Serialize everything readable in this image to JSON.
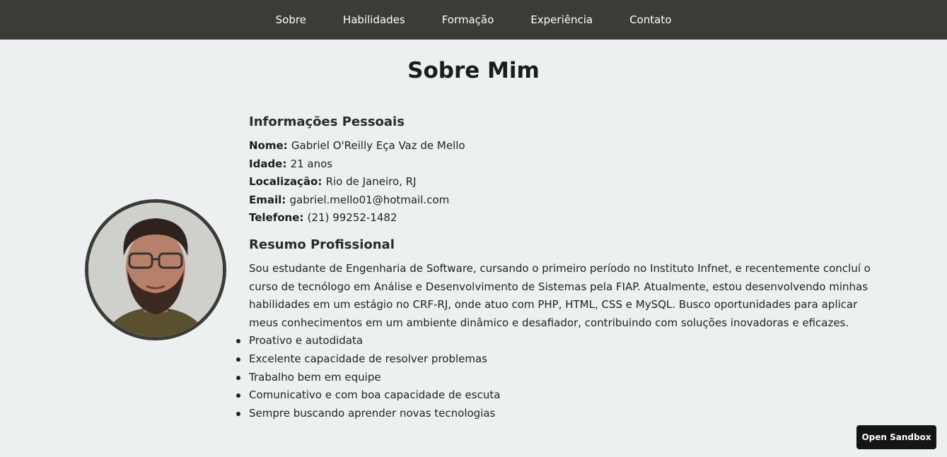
{
  "nav": {
    "items": [
      "Sobre",
      "Habilidades",
      "Formação",
      "Experiência",
      "Contato"
    ]
  },
  "page": {
    "title": "Sobre Mim"
  },
  "personal": {
    "heading": "Informações Pessoais",
    "rows": [
      {
        "label": "Nome:",
        "value": "Gabriel O'Reilly Eça Vaz de Mello"
      },
      {
        "label": "Idade:",
        "value": "21 anos"
      },
      {
        "label": "Localização:",
        "value": "Rio de Janeiro, RJ"
      },
      {
        "label": "Email:",
        "value": "gabriel.mello01@hotmail.com"
      },
      {
        "label": "Telefone:",
        "value": "(21) 99252-1482"
      }
    ]
  },
  "summary": {
    "heading": "Resumo Profissional",
    "text": "Sou estudante de Engenharia de Software, cursando o primeiro período no Instituto Infnet, e recentemente concluí o curso de tecnólogo em Análise e Desenvolvimento de Sistemas pela FIAP. Atualmente, estou desenvolvendo minhas habilidades em um estágio no CRF-RJ, onde atuo com PHP, HTML, CSS e MySQL. Busco oportunidades para aplicar meus conhecimentos em um ambiente dinâmico e desafiador, contribuindo com soluções inovadoras e eficazes.",
    "traits": [
      "Proativo e autodidata",
      "Excelente capacidade de resolver problemas",
      "Trabalho bem em equipe",
      "Comunicativo e com boa capacidade de escuta",
      "Sempre buscando aprender novas tecnologias"
    ]
  },
  "sandbox": {
    "label": "Open Sandbox"
  }
}
